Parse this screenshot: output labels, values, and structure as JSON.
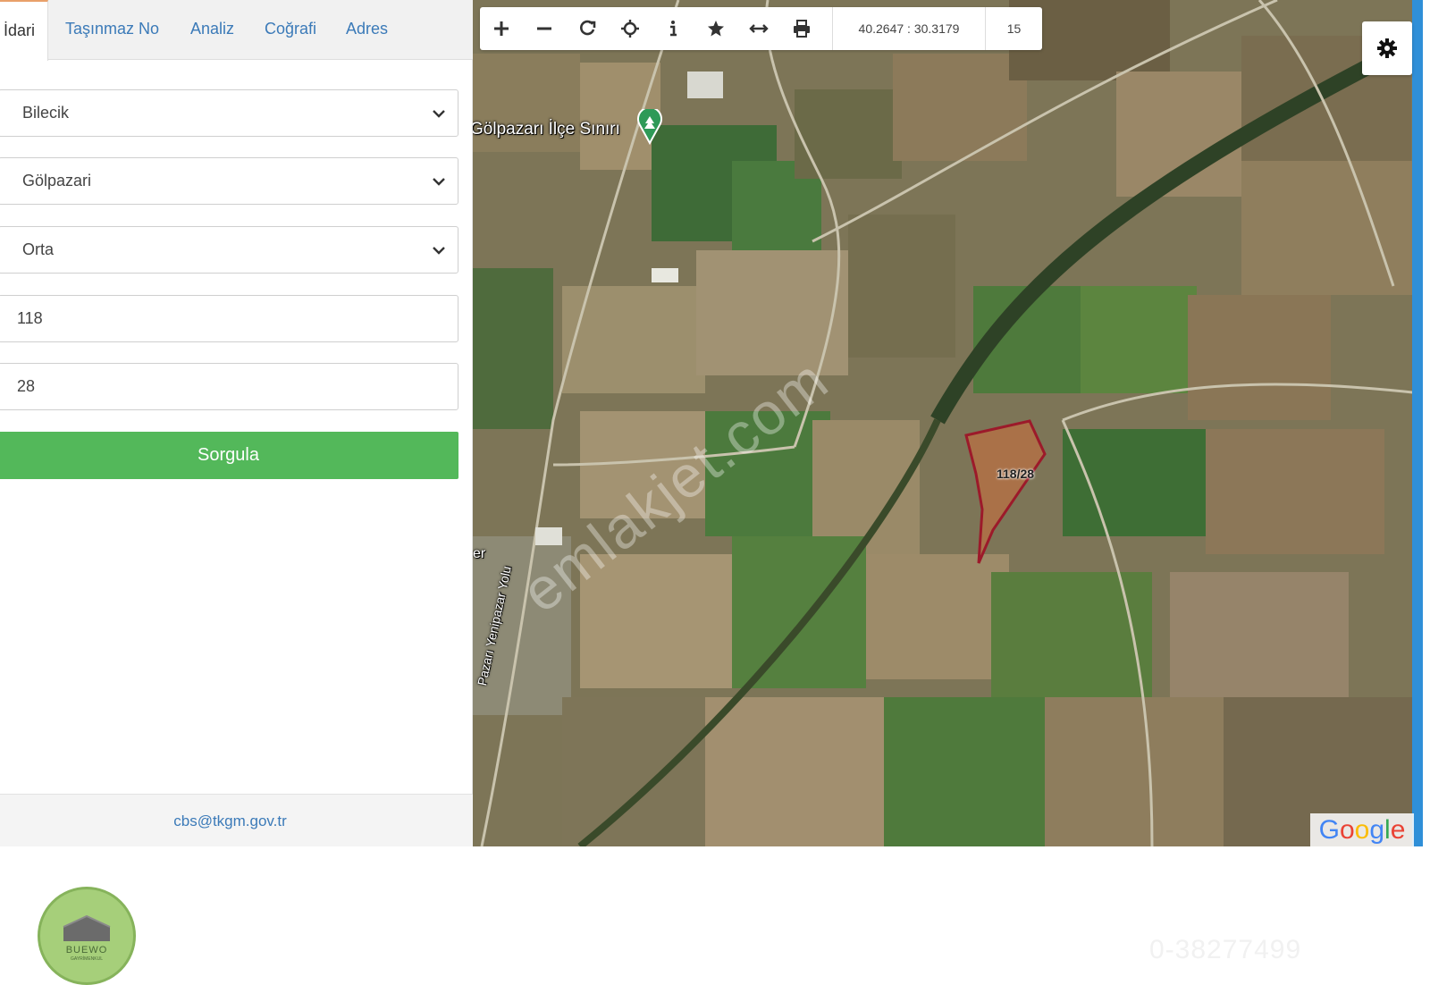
{
  "tabs": [
    {
      "label": "İdari",
      "active": true
    },
    {
      "label": "Taşınmaz No",
      "active": false
    },
    {
      "label": "Analiz",
      "active": false
    },
    {
      "label": "Coğrafi",
      "active": false
    },
    {
      "label": "Adres",
      "active": false
    }
  ],
  "form": {
    "province": "Bilecik",
    "district": "Gölpazari",
    "neighborhood": "Orta",
    "block": "118",
    "parcel": "28",
    "submit_label": "Sorgula"
  },
  "footer": {
    "email": "cbs@tkgm.gov.tr"
  },
  "map": {
    "toolbar_icons": [
      "zoom-in-icon",
      "zoom-out-icon",
      "refresh-icon",
      "locate-icon",
      "info-icon",
      "star-icon",
      "measure-icon",
      "print-icon"
    ],
    "coordinates": "40.2647 : 30.3179",
    "zoom": "15",
    "district_label": "Gölpazarı İlçe Sınırı",
    "road_label": "Pazarı Yenipazar Yolu",
    "road_label_2": "er",
    "parcel_label": "118/28",
    "watermark": "emlakjet.com",
    "attribution": "Google",
    "colors": {
      "parcel_border": "#9c1a2a",
      "accent_blue": "#2f8fd8",
      "submit_green": "#53b85a"
    }
  },
  "branding": {
    "logo_text": "BUEWO",
    "logo_subtext": "GAYRİMENKUL",
    "phone_watermark": "0-38277499"
  }
}
